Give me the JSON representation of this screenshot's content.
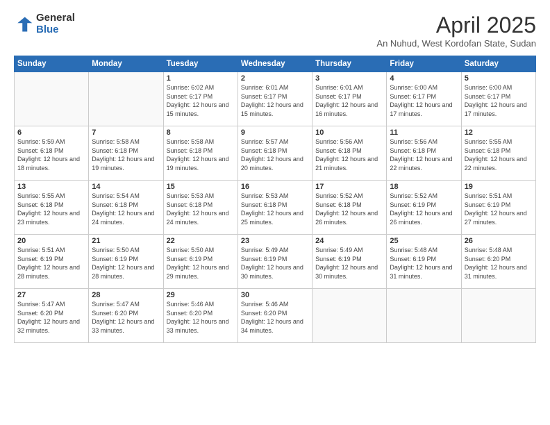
{
  "logo": {
    "general": "General",
    "blue": "Blue"
  },
  "header": {
    "title": "April 2025",
    "subtitle": "An Nuhud, West Kordofan State, Sudan"
  },
  "weekdays": [
    "Sunday",
    "Monday",
    "Tuesday",
    "Wednesday",
    "Thursday",
    "Friday",
    "Saturday"
  ],
  "weeks": [
    [
      {
        "day": "",
        "info": ""
      },
      {
        "day": "",
        "info": ""
      },
      {
        "day": "1",
        "info": "Sunrise: 6:02 AM\nSunset: 6:17 PM\nDaylight: 12 hours and 15 minutes."
      },
      {
        "day": "2",
        "info": "Sunrise: 6:01 AM\nSunset: 6:17 PM\nDaylight: 12 hours and 15 minutes."
      },
      {
        "day": "3",
        "info": "Sunrise: 6:01 AM\nSunset: 6:17 PM\nDaylight: 12 hours and 16 minutes."
      },
      {
        "day": "4",
        "info": "Sunrise: 6:00 AM\nSunset: 6:17 PM\nDaylight: 12 hours and 17 minutes."
      },
      {
        "day": "5",
        "info": "Sunrise: 6:00 AM\nSunset: 6:17 PM\nDaylight: 12 hours and 17 minutes."
      }
    ],
    [
      {
        "day": "6",
        "info": "Sunrise: 5:59 AM\nSunset: 6:18 PM\nDaylight: 12 hours and 18 minutes."
      },
      {
        "day": "7",
        "info": "Sunrise: 5:58 AM\nSunset: 6:18 PM\nDaylight: 12 hours and 19 minutes."
      },
      {
        "day": "8",
        "info": "Sunrise: 5:58 AM\nSunset: 6:18 PM\nDaylight: 12 hours and 19 minutes."
      },
      {
        "day": "9",
        "info": "Sunrise: 5:57 AM\nSunset: 6:18 PM\nDaylight: 12 hours and 20 minutes."
      },
      {
        "day": "10",
        "info": "Sunrise: 5:56 AM\nSunset: 6:18 PM\nDaylight: 12 hours and 21 minutes."
      },
      {
        "day": "11",
        "info": "Sunrise: 5:56 AM\nSunset: 6:18 PM\nDaylight: 12 hours and 22 minutes."
      },
      {
        "day": "12",
        "info": "Sunrise: 5:55 AM\nSunset: 6:18 PM\nDaylight: 12 hours and 22 minutes."
      }
    ],
    [
      {
        "day": "13",
        "info": "Sunrise: 5:55 AM\nSunset: 6:18 PM\nDaylight: 12 hours and 23 minutes."
      },
      {
        "day": "14",
        "info": "Sunrise: 5:54 AM\nSunset: 6:18 PM\nDaylight: 12 hours and 24 minutes."
      },
      {
        "day": "15",
        "info": "Sunrise: 5:53 AM\nSunset: 6:18 PM\nDaylight: 12 hours and 24 minutes."
      },
      {
        "day": "16",
        "info": "Sunrise: 5:53 AM\nSunset: 6:18 PM\nDaylight: 12 hours and 25 minutes."
      },
      {
        "day": "17",
        "info": "Sunrise: 5:52 AM\nSunset: 6:18 PM\nDaylight: 12 hours and 26 minutes."
      },
      {
        "day": "18",
        "info": "Sunrise: 5:52 AM\nSunset: 6:19 PM\nDaylight: 12 hours and 26 minutes."
      },
      {
        "day": "19",
        "info": "Sunrise: 5:51 AM\nSunset: 6:19 PM\nDaylight: 12 hours and 27 minutes."
      }
    ],
    [
      {
        "day": "20",
        "info": "Sunrise: 5:51 AM\nSunset: 6:19 PM\nDaylight: 12 hours and 28 minutes."
      },
      {
        "day": "21",
        "info": "Sunrise: 5:50 AM\nSunset: 6:19 PM\nDaylight: 12 hours and 28 minutes."
      },
      {
        "day": "22",
        "info": "Sunrise: 5:50 AM\nSunset: 6:19 PM\nDaylight: 12 hours and 29 minutes."
      },
      {
        "day": "23",
        "info": "Sunrise: 5:49 AM\nSunset: 6:19 PM\nDaylight: 12 hours and 30 minutes."
      },
      {
        "day": "24",
        "info": "Sunrise: 5:49 AM\nSunset: 6:19 PM\nDaylight: 12 hours and 30 minutes."
      },
      {
        "day": "25",
        "info": "Sunrise: 5:48 AM\nSunset: 6:19 PM\nDaylight: 12 hours and 31 minutes."
      },
      {
        "day": "26",
        "info": "Sunrise: 5:48 AM\nSunset: 6:20 PM\nDaylight: 12 hours and 31 minutes."
      }
    ],
    [
      {
        "day": "27",
        "info": "Sunrise: 5:47 AM\nSunset: 6:20 PM\nDaylight: 12 hours and 32 minutes."
      },
      {
        "day": "28",
        "info": "Sunrise: 5:47 AM\nSunset: 6:20 PM\nDaylight: 12 hours and 33 minutes."
      },
      {
        "day": "29",
        "info": "Sunrise: 5:46 AM\nSunset: 6:20 PM\nDaylight: 12 hours and 33 minutes."
      },
      {
        "day": "30",
        "info": "Sunrise: 5:46 AM\nSunset: 6:20 PM\nDaylight: 12 hours and 34 minutes."
      },
      {
        "day": "",
        "info": ""
      },
      {
        "day": "",
        "info": ""
      },
      {
        "day": "",
        "info": ""
      }
    ]
  ]
}
